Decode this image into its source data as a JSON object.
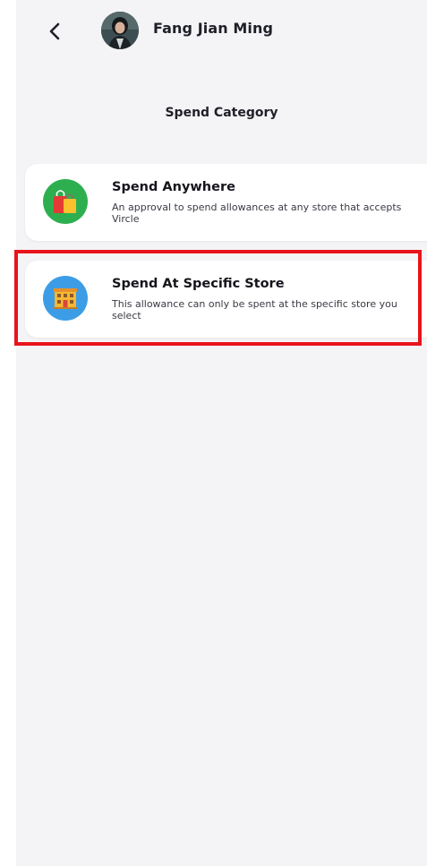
{
  "header": {
    "back_icon": "chevron-left-icon",
    "user_name": "Fang Jian Ming"
  },
  "page_title": "Spend Category",
  "categories": [
    {
      "title": "Spend Anywhere",
      "description": "An approval to spend allowances at any store that accepts Vircle",
      "icon": "shopping-bags-icon",
      "icon_bg": "#2eaf4f"
    },
    {
      "title": "Spend At Specific Store",
      "description": "This allowance can only be spent at the specific store you select",
      "icon": "store-building-icon",
      "icon_bg": "#3c9de6"
    }
  ],
  "highlight_color": "#e8141b"
}
